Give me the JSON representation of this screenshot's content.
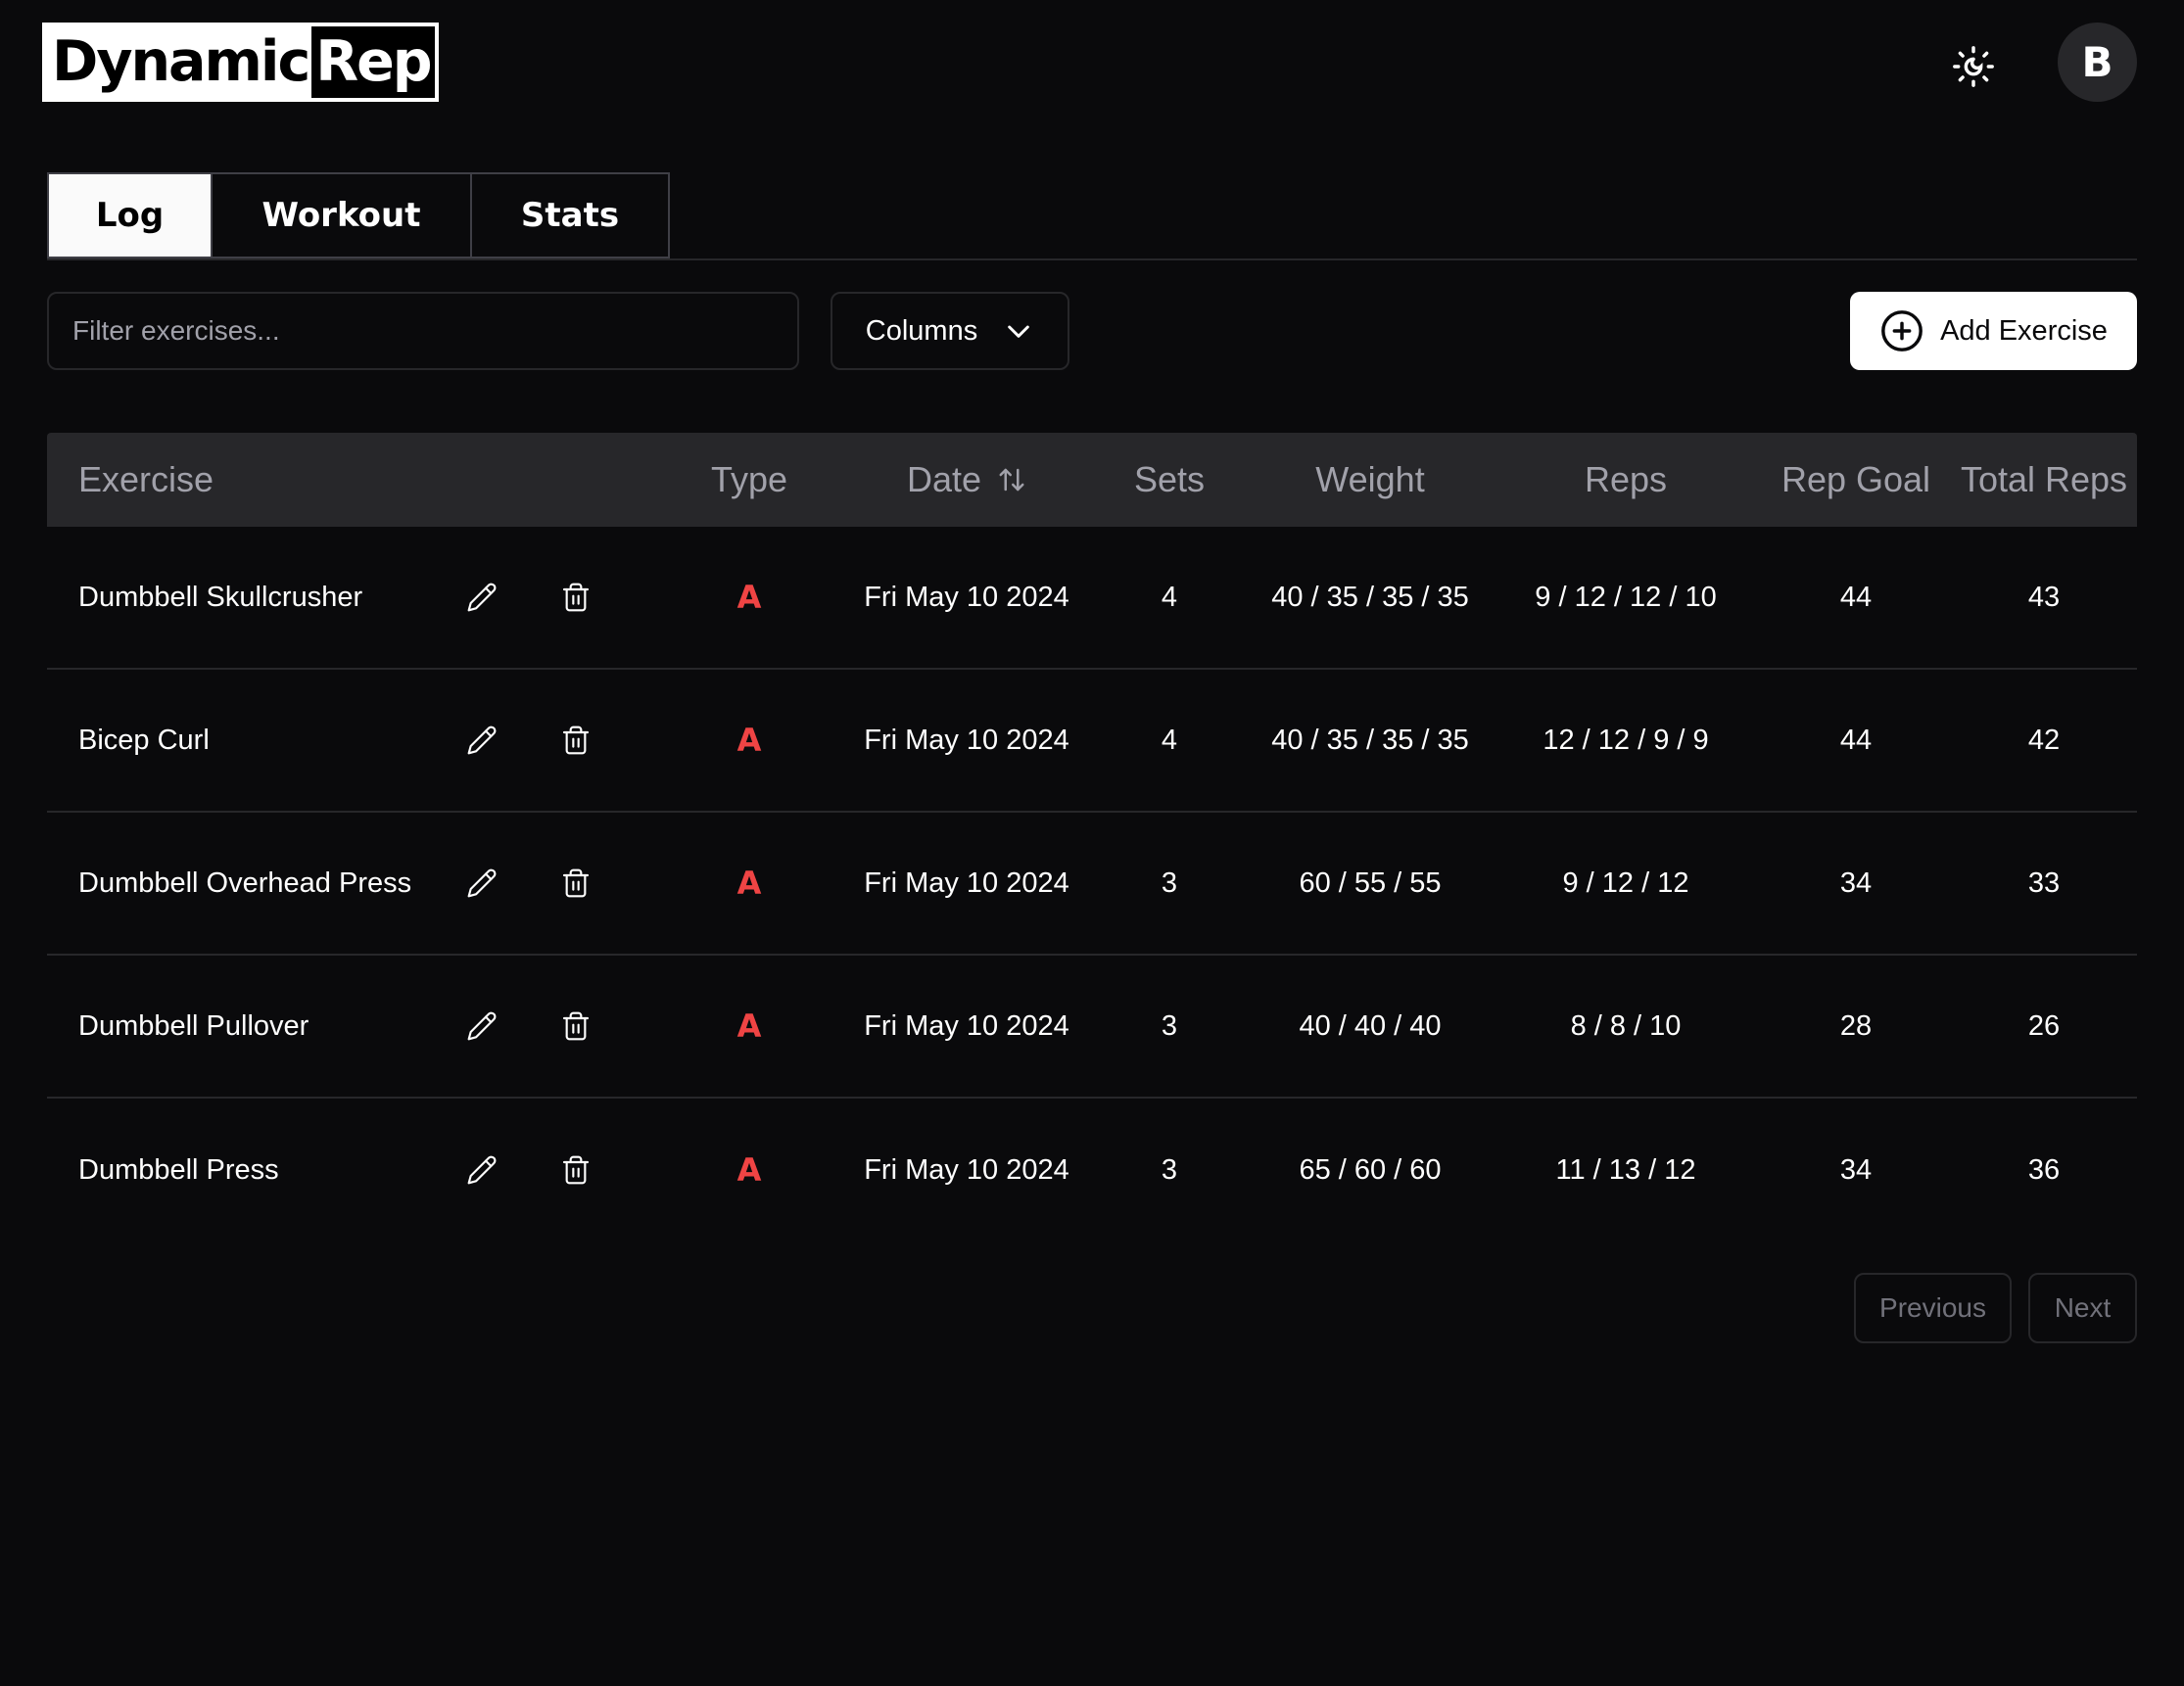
{
  "app": {
    "logo_left": "Dynamic",
    "logo_right": "Rep",
    "avatar_initial": "B",
    "theme_icon": "sun-moon-icon"
  },
  "tabs": [
    {
      "label": "Log",
      "active": true
    },
    {
      "label": "Workout",
      "active": false
    },
    {
      "label": "Stats",
      "active": false
    }
  ],
  "toolbar": {
    "filter_placeholder": "Filter exercises...",
    "filter_value": "",
    "columns_label": "Columns",
    "add_label": "Add Exercise"
  },
  "table": {
    "headers": [
      "Exercise",
      "Type",
      "Date",
      "Sets",
      "Weight",
      "Reps",
      "Rep Goal",
      "Total Reps"
    ],
    "rows": [
      {
        "exercise": "Dumbbell Skullcrusher",
        "type": "A",
        "date": "Fri May 10 2024",
        "sets": "4",
        "weight": "40 / 35 / 35 / 35",
        "reps": "9 / 12 / 12 / 10",
        "rep_goal": "44",
        "total_reps": "43"
      },
      {
        "exercise": "Bicep Curl",
        "type": "A",
        "date": "Fri May 10 2024",
        "sets": "4",
        "weight": "40 / 35 / 35 / 35",
        "reps": "12 / 12 / 9 / 9",
        "rep_goal": "44",
        "total_reps": "42"
      },
      {
        "exercise": "Dumbbell Overhead Press",
        "type": "A",
        "date": "Fri May 10 2024",
        "sets": "3",
        "weight": "60 / 55 / 55",
        "reps": "9 / 12 / 12",
        "rep_goal": "34",
        "total_reps": "33"
      },
      {
        "exercise": "Dumbbell Pullover",
        "type": "A",
        "date": "Fri May 10 2024",
        "sets": "3",
        "weight": "40 / 40 / 40",
        "reps": "8 / 8 / 10",
        "rep_goal": "28",
        "total_reps": "26"
      },
      {
        "exercise": "Dumbbell Press",
        "type": "A",
        "date": "Fri May 10 2024",
        "sets": "3",
        "weight": "65 / 60 / 60",
        "reps": "11 / 13 / 12",
        "rep_goal": "34",
        "total_reps": "36"
      }
    ]
  },
  "pagination": {
    "previous_label": "Previous",
    "next_label": "Next"
  },
  "colors": {
    "background": "#0a0a0c",
    "header_row": "#27272a",
    "type_accent": "#ef4444",
    "primary_button": "#ffffff"
  }
}
